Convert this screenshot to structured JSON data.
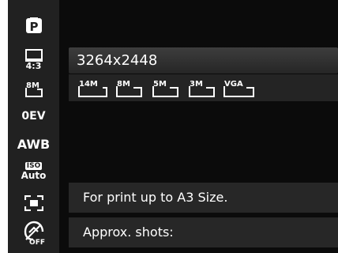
{
  "sidebar": {
    "mode_icon_letter": "P",
    "aspect_label": "4:3",
    "size_label": "8M",
    "exposure_label": "0EV",
    "wb_label": "AWB",
    "iso_top": "ISO",
    "iso_bottom": "Auto",
    "face_icon": "face-detect-icon",
    "stabilizer_icon": "stabilizer-off-icon",
    "stabilizer_label": "OFF"
  },
  "main": {
    "selected_resolution": "3264x2448",
    "size_options": [
      "14M",
      "8M",
      "5M",
      "3M",
      "VGA"
    ],
    "description": "For print up to A3 Size.",
    "approx_shots_label": "Approx. shots:"
  }
}
